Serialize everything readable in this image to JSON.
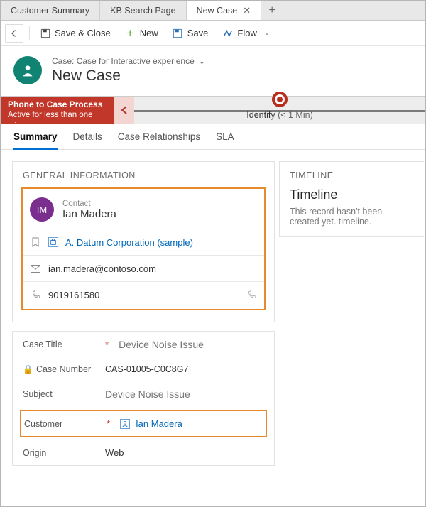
{
  "tabs": {
    "t0": "Customer Summary",
    "t1": "KB Search Page",
    "t2": "New Case"
  },
  "commands": {
    "save_close": "Save & Close",
    "new": "New",
    "save": "Save",
    "flow": "Flow"
  },
  "header": {
    "breadcrumb": "Case: Case for Interactive experience",
    "title": "New Case"
  },
  "process": {
    "name": "Phone to Case Process",
    "status": "Active for less than one mi...",
    "stage_label": "Identify",
    "stage_dur": "(< 1 Min)"
  },
  "subtabs": {
    "summary": "Summary",
    "details": "Details",
    "case_rel": "Case Relationships",
    "sla": "SLA"
  },
  "general": {
    "section_title": "GENERAL INFORMATION",
    "contact_label": "Contact",
    "initials": "IM",
    "contact_name": "Ian Madera",
    "company": "A. Datum Corporation (sample)",
    "email": "ian.madera@contoso.com",
    "phone": "9019161580"
  },
  "timeline": {
    "section_title": "TIMELINE",
    "title": "Timeline",
    "desc": "This record hasn't been created yet. timeline."
  },
  "details": {
    "case_title_lbl": "Case Title",
    "case_title_val": "Device Noise Issue",
    "case_number_lbl": "Case Number",
    "case_number_val": "CAS-01005-C0C8G7",
    "subject_lbl": "Subject",
    "subject_val": "Device Noise Issue",
    "customer_lbl": "Customer",
    "customer_val": "Ian Madera",
    "origin_lbl": "Origin",
    "origin_val": "Web",
    "req": "*"
  }
}
